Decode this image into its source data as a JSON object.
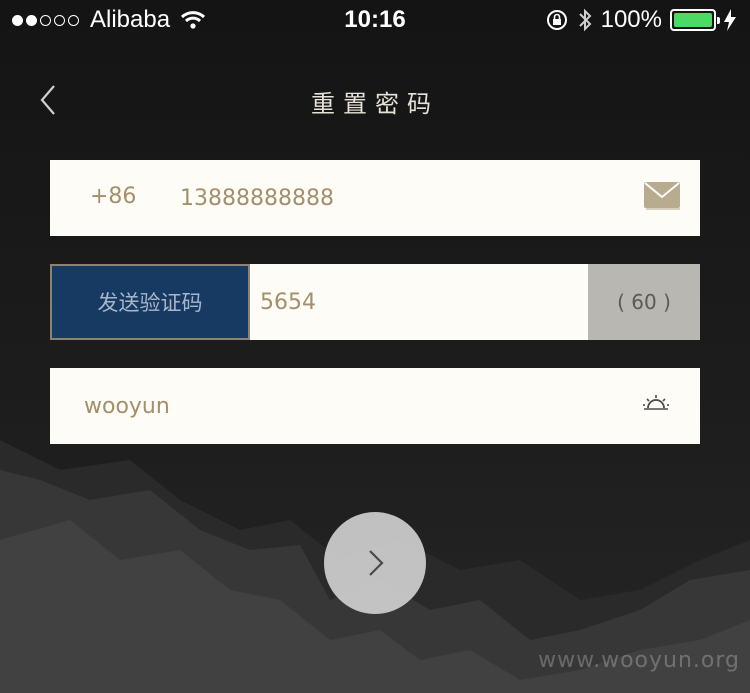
{
  "status_bar": {
    "carrier": "Alibaba",
    "time": "10:16",
    "battery_percent": "100%",
    "battery_level": 1.0,
    "signal_bars_filled": 2,
    "signal_bars_total": 5
  },
  "nav": {
    "title": "重置密码",
    "back_icon": "chevron-left-icon"
  },
  "phone_row": {
    "country_code": "+86",
    "phone_value": "13888888888",
    "icon": "mail-icon"
  },
  "code_row": {
    "send_button_label": "发送验证码",
    "code_value": "5654",
    "countdown": "( 60 )"
  },
  "password_row": {
    "value": "wooyun",
    "icon": "eye-icon"
  },
  "submit": {
    "icon": "chevron-right-icon"
  },
  "watermark": "www.wooyun.org",
  "colors": {
    "field_text": "#a3906b",
    "send_button_bg": "#173a63",
    "countdown_bg": "#b8b7b1",
    "battery": "#4cd964"
  }
}
